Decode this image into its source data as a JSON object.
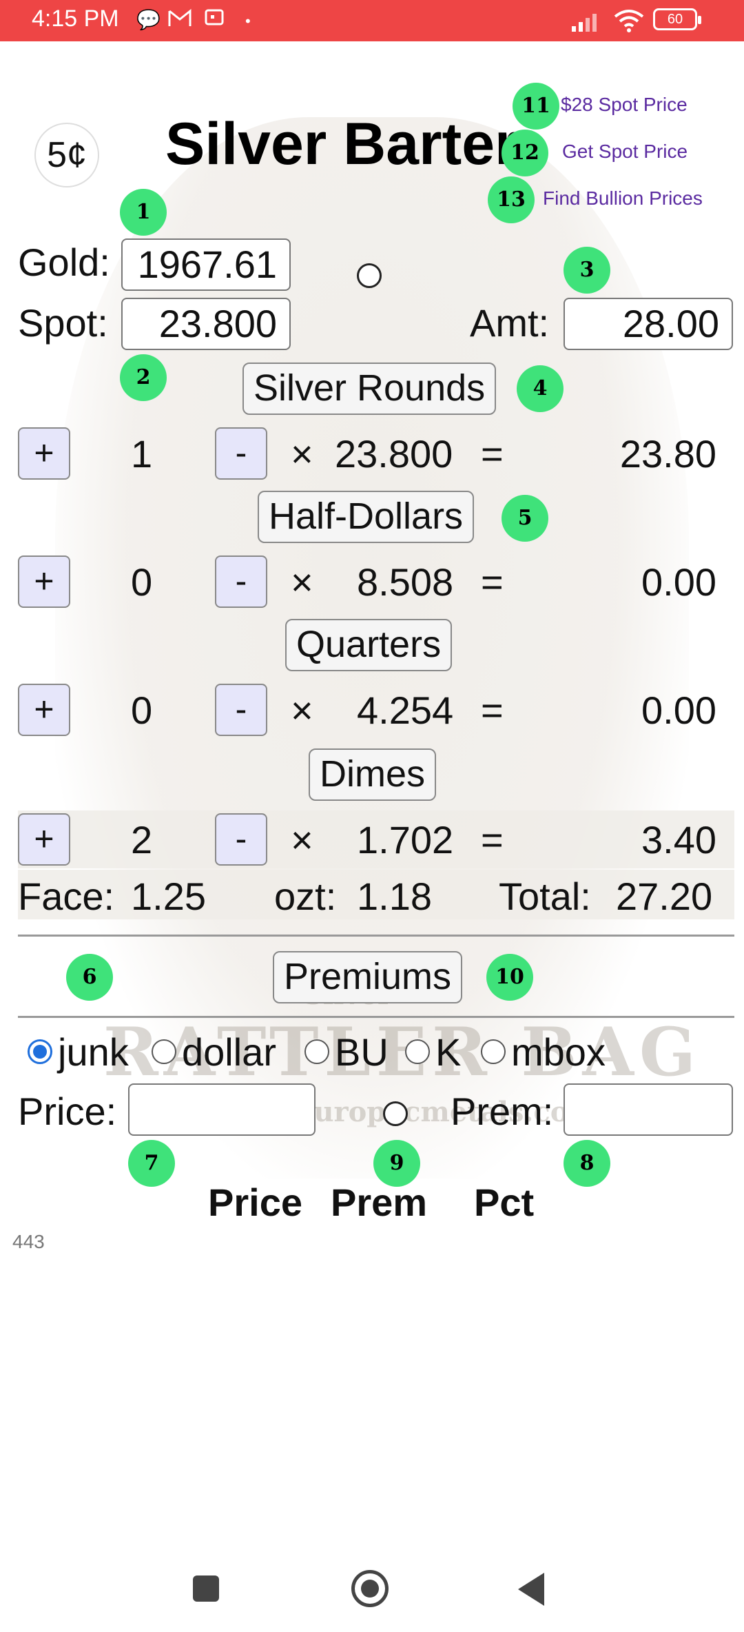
{
  "status_bar": {
    "time": "4:15 PM",
    "battery": "60"
  },
  "header": {
    "coin_label": "5¢",
    "title": "Silver Barter"
  },
  "links": {
    "spot28": "$28 Spot Price",
    "get_spot": "Get Spot Price",
    "find_bullion": "Find Bullion Prices"
  },
  "inputs": {
    "gold_label": "Gold:",
    "gold_value": "1967.61",
    "spot_label": "Spot:",
    "spot_value": "23.800",
    "amt_label": "Amt:",
    "amt_value": "28.00"
  },
  "coin_rows": [
    {
      "header": "Silver Rounds",
      "plus": "+",
      "count": "1",
      "minus": "-",
      "times": "×",
      "rate": "23.800",
      "equals": "=",
      "total": "23.80"
    },
    {
      "header": "Half-Dollars",
      "plus": "+",
      "count": "0",
      "minus": "-",
      "times": "×",
      "rate": "8.508",
      "equals": "=",
      "total": "0.00"
    },
    {
      "header": "Quarters",
      "plus": "+",
      "count": "0",
      "minus": "-",
      "times": "×",
      "rate": "4.254",
      "equals": "=",
      "total": "0.00"
    },
    {
      "header": "Dimes",
      "plus": "+",
      "count": "2",
      "minus": "-",
      "times": "×",
      "rate": "1.702",
      "equals": "=",
      "total": "3.40"
    }
  ],
  "summary": {
    "face_label": "Face:",
    "face_value": "1.25",
    "ozt_label": "ozt:",
    "ozt_value": "1.18",
    "total_label": "Total:",
    "total_value": "27.20"
  },
  "premiums": {
    "button": "Premiums",
    "options": [
      "junk",
      "dollar",
      "BU",
      "K",
      "mbox"
    ],
    "selected": "junk",
    "price_label": "Price:",
    "price_value": "",
    "prem_label": "Prem:",
    "prem_value": ""
  },
  "results_table": {
    "columns": [
      "Price",
      "Prem",
      "Pct"
    ]
  },
  "footer_number": "443",
  "badges": [
    "1",
    "2",
    "3",
    "4",
    "5",
    "6",
    "7",
    "8",
    "9",
    "10",
    "11",
    "12",
    "13"
  ],
  "colors": {
    "status_bar": "#ee4545",
    "badge": "#3fe27a",
    "link": "#5a2aa0",
    "radio_selected": "#1f6fdc",
    "stepper_bg": "#e6e6fa"
  },
  "background_image": {
    "visible_words": [
      "Silver",
      "RATTLER BAG",
      "europacmetals.com"
    ]
  }
}
